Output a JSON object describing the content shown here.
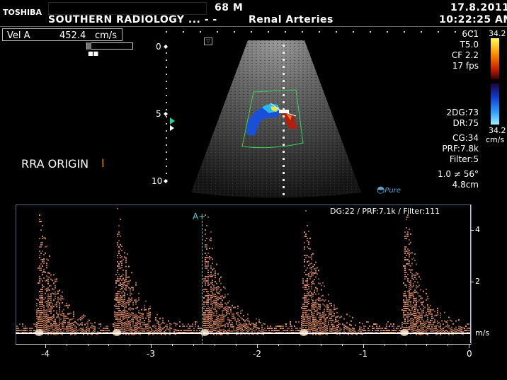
{
  "header": {
    "brand": "TOSHIBA",
    "site": "SOUTHERN RADIOLOGY ... -  -",
    "age_sex": "68  M",
    "exam": "Renal Arteries",
    "date": "17.8.2011",
    "time": "10:22:25 AM"
  },
  "measurement": {
    "label": "Vel  A",
    "value": "452.4",
    "unit": "cm/s"
  },
  "depth_scale": [
    "0",
    "5",
    "10"
  ],
  "annotation": "RRA ORIGIN",
  "settings_top": [
    "6C1",
    "T5.0",
    "CF 2.2",
    "17 fps"
  ],
  "settings_mid": [
    "2DG:73",
    "DR:75",
    "CG:34",
    "PRF:7.8k",
    "Filter:5",
    "1.0 ≠ 56°",
    "4.8cm"
  ],
  "color_scale": {
    "top": "34.2",
    "bottom": "34.2",
    "unit": "cm/s"
  },
  "logo": "Pure",
  "doppler": {
    "header": "DG:22 /    PRF:7.1k    / Filter:111",
    "marker": "A+",
    "y_ticks": [
      "4",
      "2"
    ],
    "y_unit": "m/s",
    "x_ticks": [
      "-4",
      "-3",
      "-2",
      "-1",
      "0"
    ]
  }
}
